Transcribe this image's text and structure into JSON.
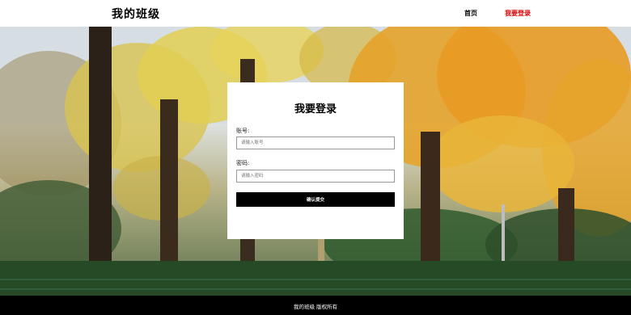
{
  "header": {
    "logo": "我的班级",
    "nav": {
      "home": "首页",
      "login": "我要登录"
    }
  },
  "login_form": {
    "title": "我要登录",
    "account_label": "账号:",
    "account_placeholder": "请输入账号",
    "password_label": "密码:",
    "password_placeholder": "请输入密码",
    "submit_label": "确认提交"
  },
  "footer": {
    "text": "我的班级 版权所有"
  },
  "colors": {
    "active_nav": "#e00000",
    "button_bg": "#000000",
    "footer_bg": "#000000"
  }
}
